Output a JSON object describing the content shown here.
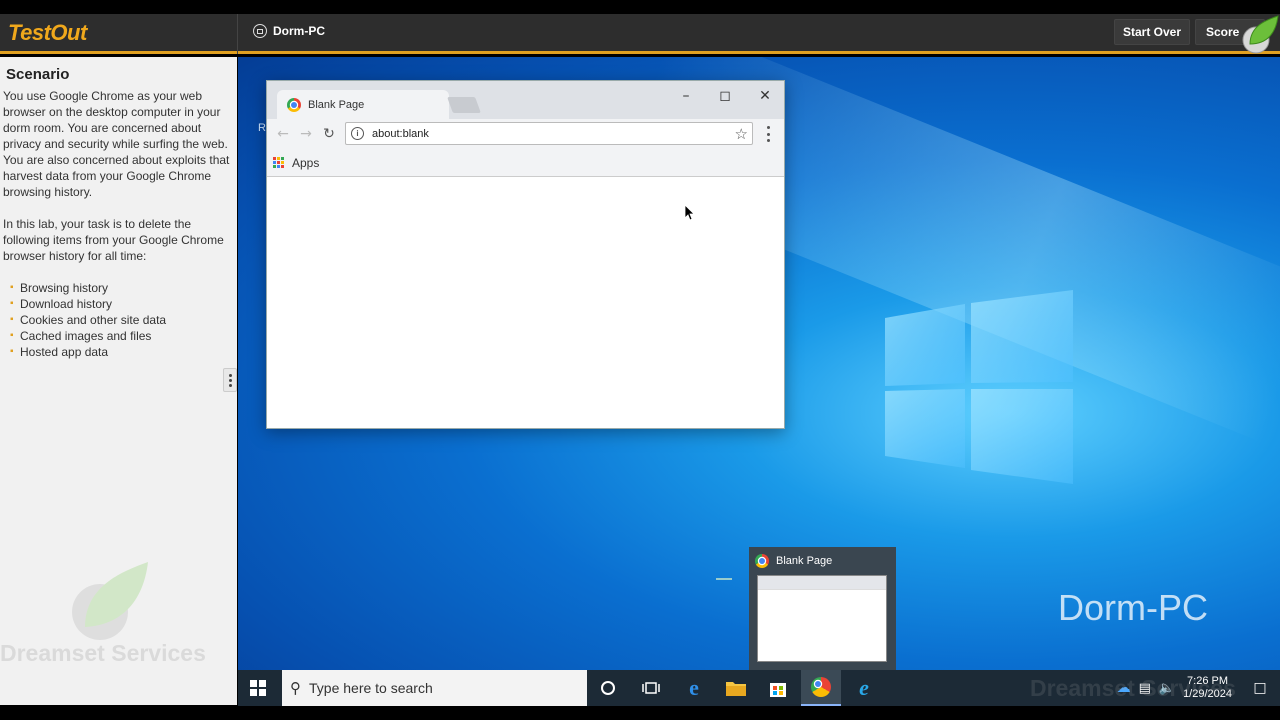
{
  "app": {
    "logo": "TestOut",
    "pc_name": "Dorm-PC",
    "start_over_label": "Start Over",
    "score_label": "Score"
  },
  "scenario": {
    "heading": "Scenario",
    "paragraph1": "You use Google Chrome as your web browser on the desktop computer in your dorm room. You are concerned about privacy and security while surfing the web. You are also concerned about exploits that harvest data from your Google Chrome browsing history.",
    "paragraph2": "In this lab, your task is to delete the following items from your Google Chrome browser history for all time:",
    "tasks": [
      "Browsing history",
      "Download history",
      "Cookies and other site data",
      "Cached images and files",
      "Hosted app data"
    ]
  },
  "watermark": {
    "left": "Dreamset Services",
    "right": "Dreamset Services"
  },
  "browser": {
    "tab_title": "Blank Page",
    "url": "about:blank",
    "bookmarks_apps_label": "Apps",
    "icons": {
      "back": "back-arrow-icon",
      "forward": "forward-arrow-icon",
      "reload": "reload-icon",
      "star": "star-icon",
      "menu": "kebab-menu-icon"
    }
  },
  "desktop": {
    "label": "Dorm-PC",
    "partial_icon_text": "R"
  },
  "taskbar_preview": {
    "title": "Blank Page"
  },
  "taskbar": {
    "search_placeholder": "Type here to search",
    "time": "7:26 PM",
    "date": "1/29/2024",
    "pinned": [
      "cortana-icon",
      "task-view-icon",
      "edge-icon",
      "file-explorer-icon",
      "store-icon",
      "chrome-icon",
      "internet-explorer-icon"
    ]
  },
  "colors": {
    "accent": "#e0a020",
    "header_bg": "#2d2d2d",
    "taskbar_bg": "#1c2a36"
  }
}
